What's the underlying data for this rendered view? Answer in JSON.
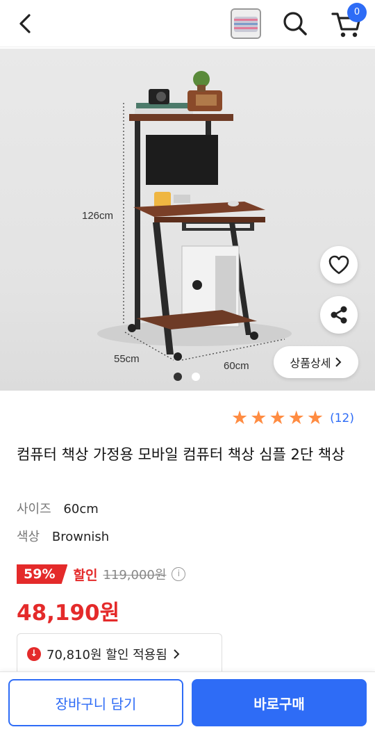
{
  "header": {
    "cart_count": "0"
  },
  "hero": {
    "dim_height": "126cm",
    "dim_depth": "55cm",
    "dim_width": "60cm",
    "detail_label": "상품상세",
    "active_slide": 1,
    "slide_count": 2
  },
  "rating": {
    "stars": 5,
    "review_count": "(12)"
  },
  "product": {
    "title": "컴퓨터 책상 가정용 모바일 컴퓨터 책상 심플 2단 책상",
    "options": [
      {
        "key": "사이즈",
        "value": "60cm"
      },
      {
        "key": "색상",
        "value": "Brownish"
      }
    ],
    "discount_percent": "59%",
    "discount_word": "할인",
    "original_price": "119,000원",
    "price": "48,190원",
    "coupon_text": "70,810원 할인 적용됨"
  },
  "actions": {
    "add_to_cart": "장바구니 담기",
    "buy_now": "바로구매"
  },
  "colors": {
    "accent": "#2e6cf6",
    "sale": "#e42a2a",
    "star": "#ff8c42"
  }
}
